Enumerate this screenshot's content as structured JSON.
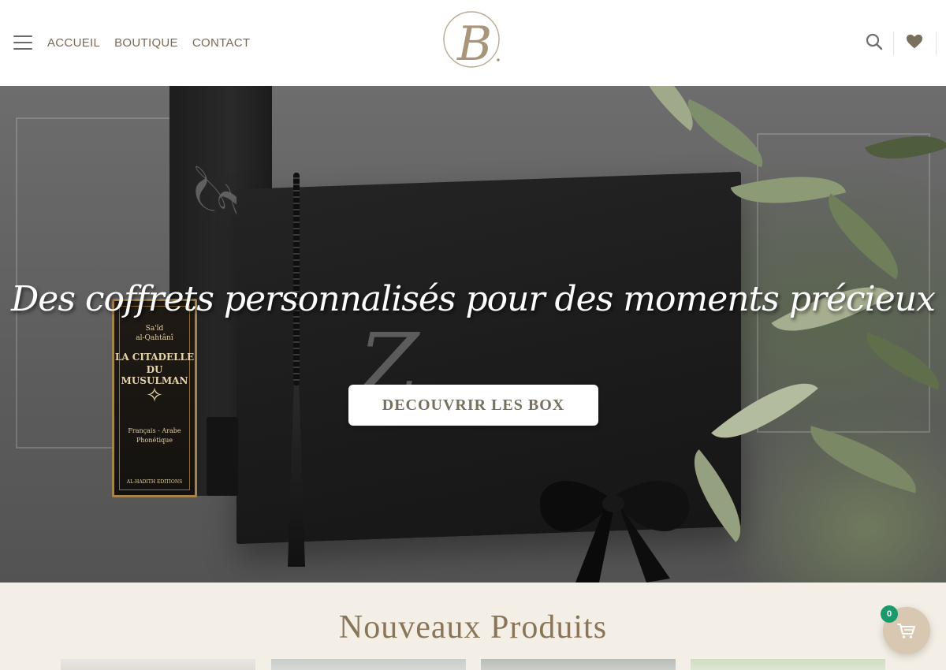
{
  "header": {
    "nav": [
      "ACCUEIL",
      "BOUTIQUE",
      "CONTACT"
    ],
    "icons": [
      "menu-icon",
      "search-icon",
      "heart-icon",
      "user-icon"
    ],
    "logo_letter": "B",
    "accent_color": "#7a6a55"
  },
  "hero": {
    "title": "Des coffrets personnalisés pour des moments précieux",
    "cta_label": "DECOUVRIR LES BOX",
    "book_lines": [
      "Sa'îd",
      "al-Qahtânî",
      "LA CITADELLE",
      "DU MUSULMAN",
      "Français - Arabe",
      "Phonétique",
      "AL-HADITH EDITIONS"
    ]
  },
  "section": {
    "title": "Nouveaux Produits"
  },
  "cart": {
    "count": "0",
    "badge_color": "#1a9a6c"
  }
}
